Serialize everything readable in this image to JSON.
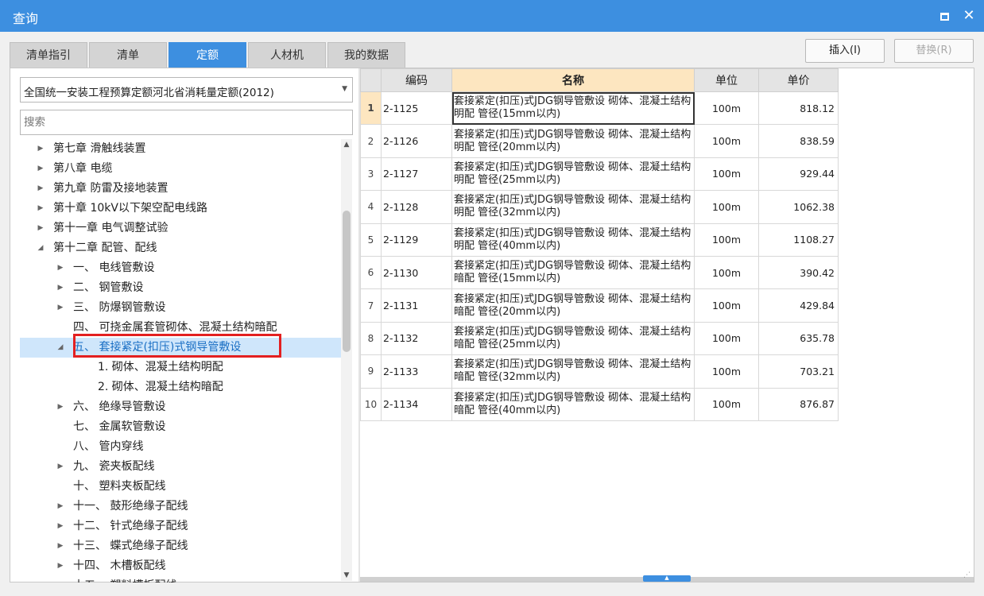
{
  "window": {
    "title": "查询"
  },
  "tabs": [
    {
      "label": "清单指引"
    },
    {
      "label": "清单"
    },
    {
      "label": "定额"
    },
    {
      "label": "人材机"
    },
    {
      "label": "我的数据"
    }
  ],
  "buttons": {
    "insert": "插入(I)",
    "replace": "替换(R)"
  },
  "library": {
    "selected": "全国统一安装工程预算定额河北省消耗量定额(2012)"
  },
  "search": {
    "placeholder": "搜索"
  },
  "tree": [
    {
      "label": "第七章 滑触线装置",
      "level": 0,
      "expander": "collapsed"
    },
    {
      "label": "第八章 电缆",
      "level": 0,
      "expander": "collapsed"
    },
    {
      "label": "第九章 防雷及接地装置",
      "level": 0,
      "expander": "collapsed"
    },
    {
      "label": "第十章 10kV以下架空配电线路",
      "level": 0,
      "expander": "collapsed"
    },
    {
      "label": "第十一章 电气调整试验",
      "level": 0,
      "expander": "collapsed"
    },
    {
      "label": "第十二章 配管、配线",
      "level": 0,
      "expander": "expanded"
    },
    {
      "label": "一、 电线管敷设",
      "level": 1,
      "expander": "collapsed"
    },
    {
      "label": "二、 钢管敷设",
      "level": 1,
      "expander": "collapsed"
    },
    {
      "label": "三、 防爆钢管敷设",
      "level": 1,
      "expander": "collapsed"
    },
    {
      "label": "四、 可挠金属套管砌体、混凝土结构暗配",
      "level": 1,
      "expander": "none"
    },
    {
      "label": "五、 套接紧定(扣压)式钢导管敷设",
      "level": 1,
      "expander": "expanded",
      "selected": true
    },
    {
      "label": "1. 砌体、混凝土结构明配",
      "level": 2,
      "expander": "none"
    },
    {
      "label": "2. 砌体、混凝土结构暗配",
      "level": 2,
      "expander": "none"
    },
    {
      "label": "六、 绝缘导管敷设",
      "level": 1,
      "expander": "collapsed"
    },
    {
      "label": "七、 金属软管敷设",
      "level": 1,
      "expander": "none"
    },
    {
      "label": "八、 管内穿线",
      "level": 1,
      "expander": "none"
    },
    {
      "label": "九、 瓷夹板配线",
      "level": 1,
      "expander": "collapsed"
    },
    {
      "label": "十、 塑料夹板配线",
      "level": 1,
      "expander": "none"
    },
    {
      "label": "十一、 鼓形绝缘子配线",
      "level": 1,
      "expander": "collapsed"
    },
    {
      "label": "十二、 针式绝缘子配线",
      "level": 1,
      "expander": "collapsed"
    },
    {
      "label": "十三、 蝶式绝缘子配线",
      "level": 1,
      "expander": "collapsed"
    },
    {
      "label": "十四、 木槽板配线",
      "level": 1,
      "expander": "collapsed"
    },
    {
      "label": "十五、 塑料槽板配线",
      "level": 1,
      "expander": "collapsed"
    }
  ],
  "table": {
    "columns": [
      "",
      "编码",
      "名称",
      "单位",
      "单价"
    ],
    "rows": [
      {
        "no": "1",
        "code": "2-1125",
        "name": "套接紧定(扣压)式JDG钢导管敷设 砌体、混凝土结构明配 管径(15mm以内)",
        "unit": "100m",
        "price": "818.12"
      },
      {
        "no": "2",
        "code": "2-1126",
        "name": "套接紧定(扣压)式JDG钢导管敷设 砌体、混凝土结构明配 管径(20mm以内)",
        "unit": "100m",
        "price": "838.59"
      },
      {
        "no": "3",
        "code": "2-1127",
        "name": "套接紧定(扣压)式JDG钢导管敷设 砌体、混凝土结构明配 管径(25mm以内)",
        "unit": "100m",
        "price": "929.44"
      },
      {
        "no": "4",
        "code": "2-1128",
        "name": "套接紧定(扣压)式JDG钢导管敷设 砌体、混凝土结构明配 管径(32mm以内)",
        "unit": "100m",
        "price": "1062.38"
      },
      {
        "no": "5",
        "code": "2-1129",
        "name": "套接紧定(扣压)式JDG钢导管敷设 砌体、混凝土结构明配 管径(40mm以内)",
        "unit": "100m",
        "price": "1108.27"
      },
      {
        "no": "6",
        "code": "2-1130",
        "name": "套接紧定(扣压)式JDG钢导管敷设 砌体、混凝土结构暗配 管径(15mm以内)",
        "unit": "100m",
        "price": "390.42"
      },
      {
        "no": "7",
        "code": "2-1131",
        "name": "套接紧定(扣压)式JDG钢导管敷设 砌体、混凝土结构暗配 管径(20mm以内)",
        "unit": "100m",
        "price": "429.84"
      },
      {
        "no": "8",
        "code": "2-1132",
        "name": "套接紧定(扣压)式JDG钢导管敷设 砌体、混凝土结构暗配 管径(25mm以内)",
        "unit": "100m",
        "price": "635.78"
      },
      {
        "no": "9",
        "code": "2-1133",
        "name": "套接紧定(扣压)式JDG钢导管敷设 砌体、混凝土结构暗配 管径(32mm以内)",
        "unit": "100m",
        "price": "703.21"
      },
      {
        "no": "10",
        "code": "2-1134",
        "name": "套接紧定(扣压)式JDG钢导管敷设 砌体、混凝土结构暗配 管径(40mm以内)",
        "unit": "100m",
        "price": "876.87"
      }
    ]
  },
  "colors": {
    "accent": "#3d8fe0",
    "highlight_border": "#e32020",
    "selected_bg": "#cfe6fb",
    "header_name_bg": "#fde6c0"
  }
}
